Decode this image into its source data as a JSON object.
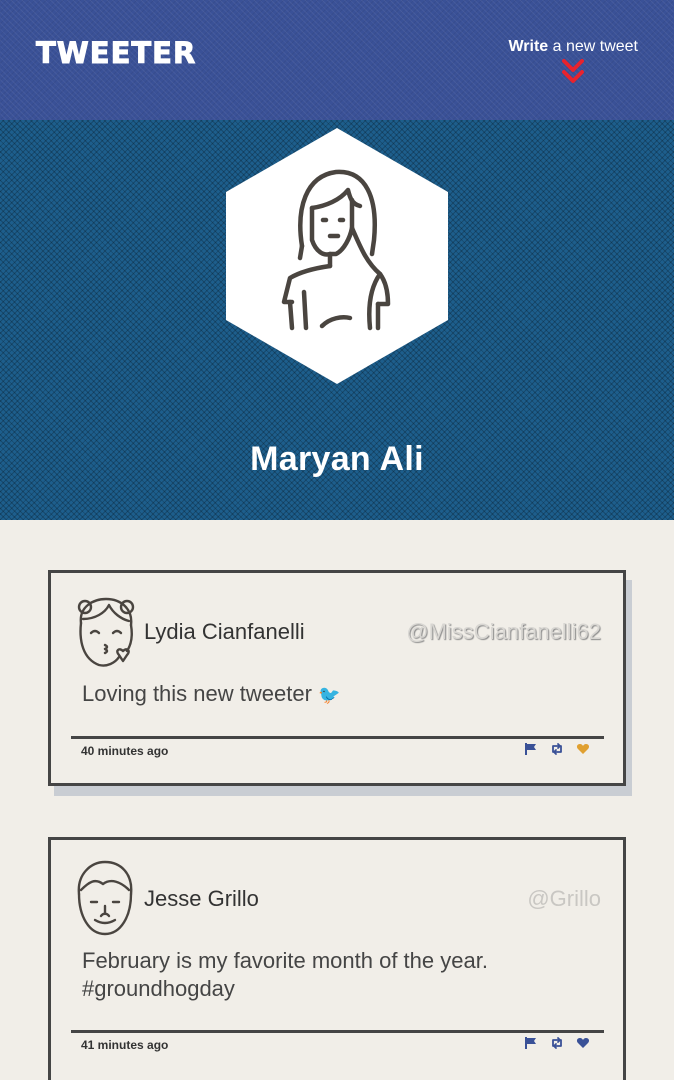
{
  "nav": {
    "brand": "TWEETER",
    "compose_bold": "Write",
    "compose_rest": " a new tweet",
    "compose_icon": "double-chevron-down-icon"
  },
  "profile": {
    "name": "Maryan Ali",
    "avatar_icon": "woman-avatar-icon"
  },
  "tweets": [
    {
      "name": "Lydia Cianfanelli",
      "handle": "@MissCianfanelli62",
      "text": "Loving this new tweeter",
      "emoji": "🐦",
      "time": "40 minutes ago",
      "avatar_icon": "girl-kiss-avatar-icon",
      "liked": true
    },
    {
      "name": "Jesse Grillo",
      "handle": "@Grillo",
      "text": "February is my favorite month of the year. #groundhogday",
      "time": "41 minutes ago",
      "avatar_icon": "man-avatar-icon",
      "liked": false
    }
  ],
  "colors": {
    "nav": "#3a5197",
    "profile": "#1d5e8c",
    "background": "#f1eee8",
    "action": "#3a5197",
    "like_active": "#e0a030",
    "compose_arrow": "#e8232e"
  }
}
